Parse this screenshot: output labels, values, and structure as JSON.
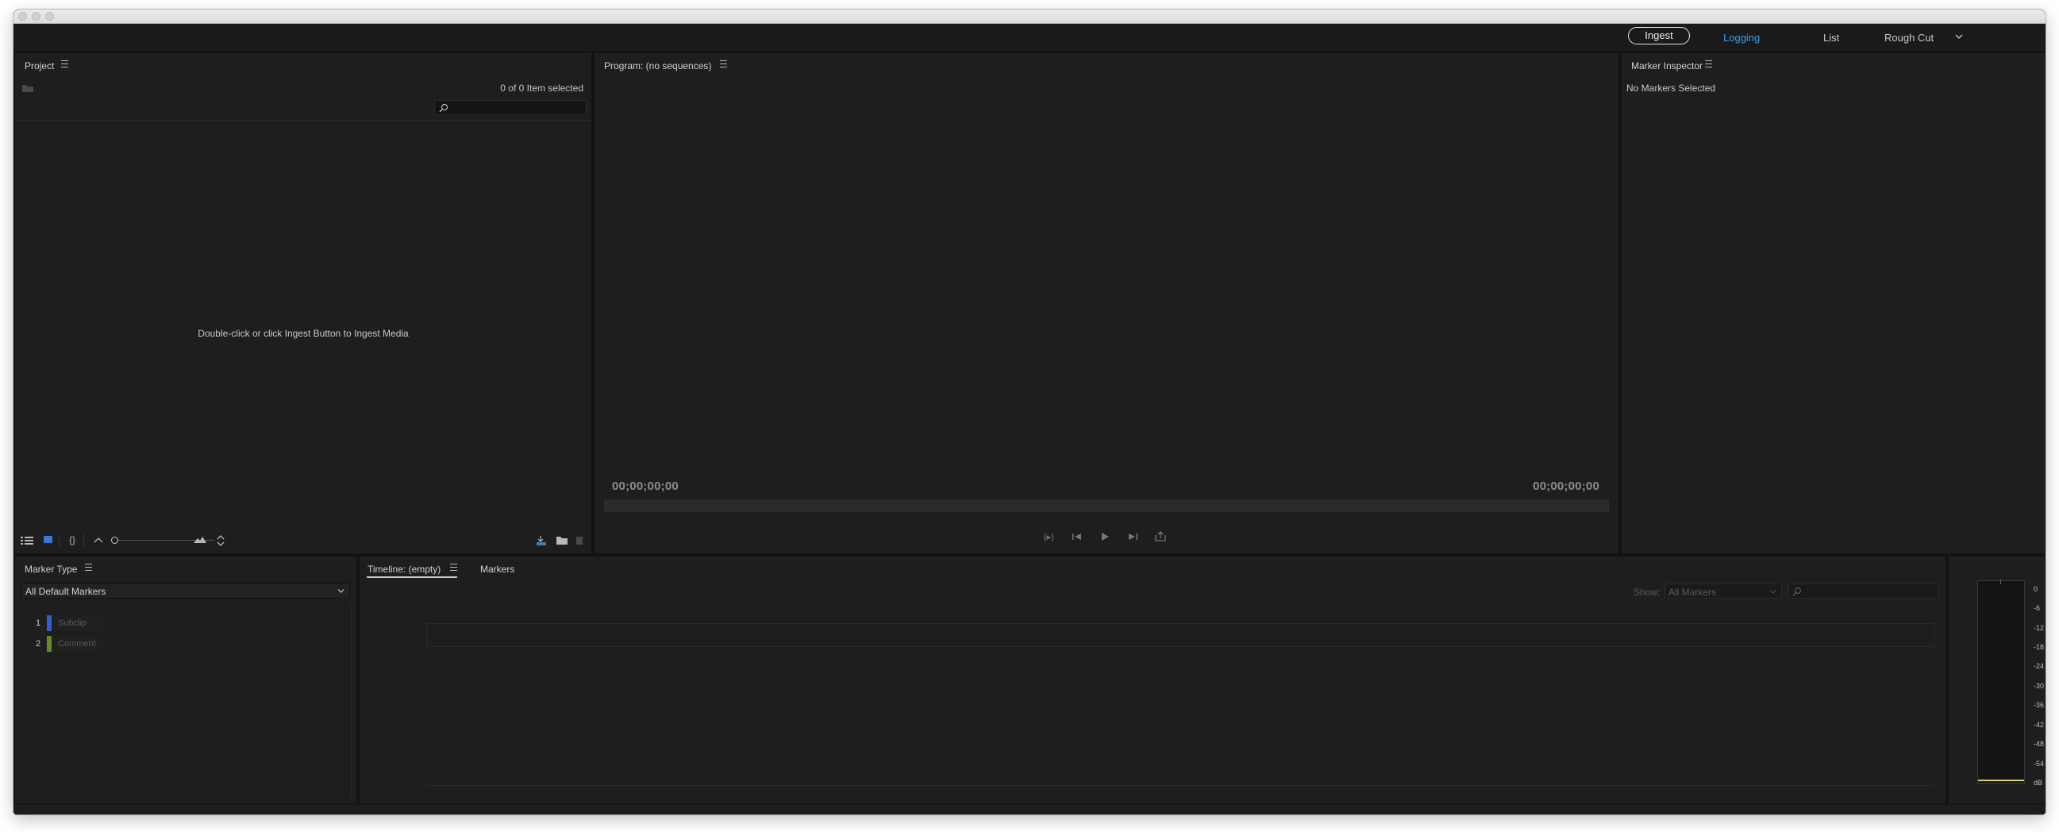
{
  "workspaces": {
    "tabs": [
      {
        "label": "Ingest"
      },
      {
        "label": "Logging"
      },
      {
        "label": "List"
      },
      {
        "label": "Rough Cut"
      }
    ],
    "more_icon": "chevron-down-icon"
  },
  "project": {
    "title": "Project",
    "selection_count": "0 of 0 Item selected",
    "empty_message": "Double-click or click Ingest Button to Ingest Media",
    "search_placeholder": ""
  },
  "program": {
    "title": "Program: (no sequences)",
    "timecode_in": "00;00;00;00",
    "timecode_out": "00;00;00;00"
  },
  "marker_inspector": {
    "title": "Marker Inspector",
    "status": "No Markers Selected"
  },
  "marker_type": {
    "title": "Marker Type",
    "dropdown_value": "All Default Markers",
    "items": [
      {
        "num": "1",
        "label": "Subclip",
        "color": "#2f5fd0"
      },
      {
        "num": "2",
        "label": "Comment",
        "color": "#6a8a2a"
      }
    ]
  },
  "timeline": {
    "tabs": [
      {
        "label": "Timeline: (empty)"
      },
      {
        "label": "Markers"
      }
    ],
    "show_label": "Show:",
    "show_value": "All Markers"
  },
  "audio_meter": {
    "ticks": [
      "0",
      "-6",
      "-12",
      "-18",
      "-24",
      "-30",
      "-36",
      "-42",
      "-48",
      "-54",
      "dB"
    ]
  },
  "colors": {
    "accent": "#3d9bea",
    "panel_bg": "#1e1e1e",
    "window_bg": "#121212"
  }
}
